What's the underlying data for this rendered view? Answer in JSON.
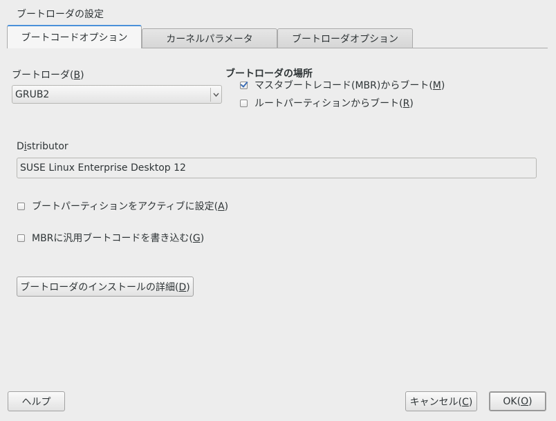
{
  "window": {
    "title": "ブートローダの設定"
  },
  "tabs": [
    {
      "label": "ブートコードオプション",
      "active": true
    },
    {
      "label": "カーネルパラメータ",
      "active": false
    },
    {
      "label": "ブートローダオプション",
      "active": false
    }
  ],
  "bootloader": {
    "label_prefix": "ブートローダ(",
    "mnemonic": "B",
    "label_suffix": ")",
    "selected": "GRUB2",
    "dropdown_icon": "chevron-down-icon"
  },
  "location": {
    "heading": "ブートローダの場所",
    "options": [
      {
        "label_prefix": "マスタブートレコード(MBR)からブート(",
        "mnemonic": "M",
        "label_suffix": ")",
        "checked": true
      },
      {
        "label_prefix": "ルートパーティションからブート(",
        "mnemonic": "R",
        "label_suffix": ")",
        "checked": false
      }
    ]
  },
  "distributor": {
    "label_first": "D",
    "label_mnemonic": "i",
    "label_rest": "stributor",
    "value": "SUSE Linux Enterprise Desktop 12"
  },
  "options": [
    {
      "label_prefix": "ブートパーティションをアクティブに設定(",
      "mnemonic": "A",
      "label_suffix": ")",
      "checked": false
    },
    {
      "label_prefix": "MBRに汎用ブートコードを書き込む(",
      "mnemonic": "G",
      "label_suffix": ")",
      "checked": false
    }
  ],
  "buttons": {
    "details": {
      "label_prefix": "ブートローダのインストールの詳細(",
      "mnemonic": "D",
      "label_suffix": ")"
    },
    "help": {
      "label": "ヘルプ"
    },
    "cancel": {
      "label_prefix": "キャンセル(",
      "mnemonic": "C",
      "label_suffix": ")"
    },
    "ok": {
      "label_prefix": "OK(",
      "mnemonic": "O",
      "label_suffix": ")"
    }
  },
  "colors": {
    "background": "#ededed",
    "active_tab_accent": "#4a90d9",
    "checkmark": "#3b6db5"
  }
}
